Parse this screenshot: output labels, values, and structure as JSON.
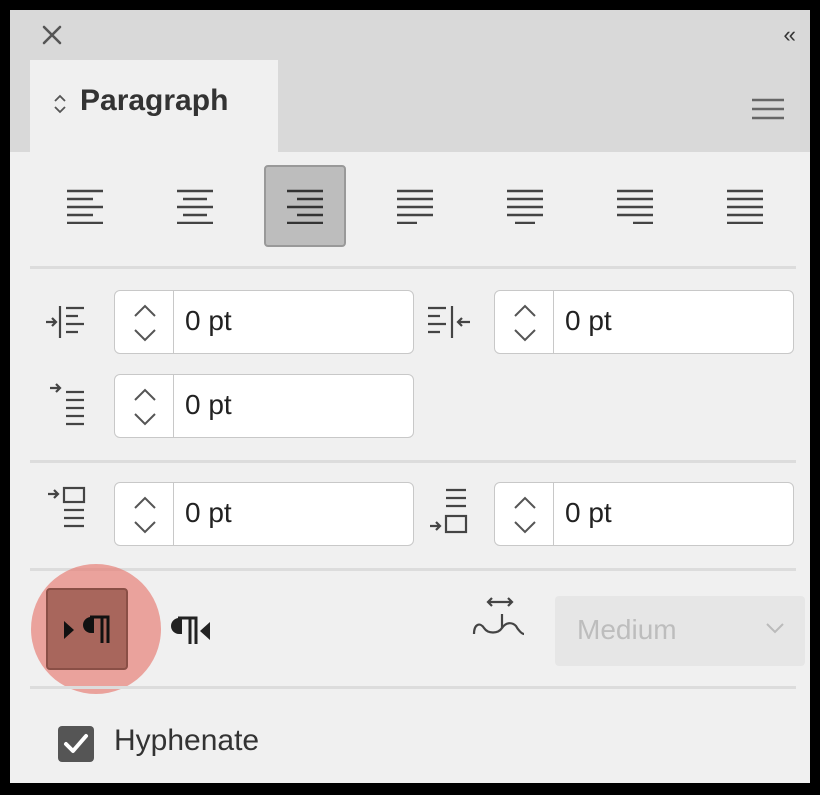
{
  "window": {
    "close_icon": "close-icon",
    "collapse_label": "‹‹"
  },
  "tab": {
    "title": "Paragraph",
    "arrow_icon": "updown-icon",
    "menu_icon": "hamburger-icon"
  },
  "alignment": {
    "buttons": [
      {
        "name": "align-left",
        "active": false
      },
      {
        "name": "align-center",
        "active": false
      },
      {
        "name": "align-right",
        "active": true
      },
      {
        "name": "justify-last-left",
        "active": false
      },
      {
        "name": "justify-last-center",
        "active": false
      },
      {
        "name": "justify-last-right",
        "active": false
      },
      {
        "name": "justify-all",
        "active": false
      }
    ]
  },
  "indents": {
    "left_indent": "0 pt",
    "right_indent": "0 pt",
    "first_line_indent": "0 pt"
  },
  "spacing": {
    "space_before": "0 pt",
    "space_after": "0 pt"
  },
  "direction": {
    "ltr_active": true,
    "ltr_icon": "ltr-paragraph-icon",
    "rtl_icon": "rtl-paragraph-icon"
  },
  "kashida": {
    "icon": "kashida-icon",
    "value": "Medium"
  },
  "hyphenate": {
    "label": "Hyphenate",
    "checked": true
  },
  "colors": {
    "accent_highlight": "#e6786e",
    "panel": "#f0f0f0"
  }
}
